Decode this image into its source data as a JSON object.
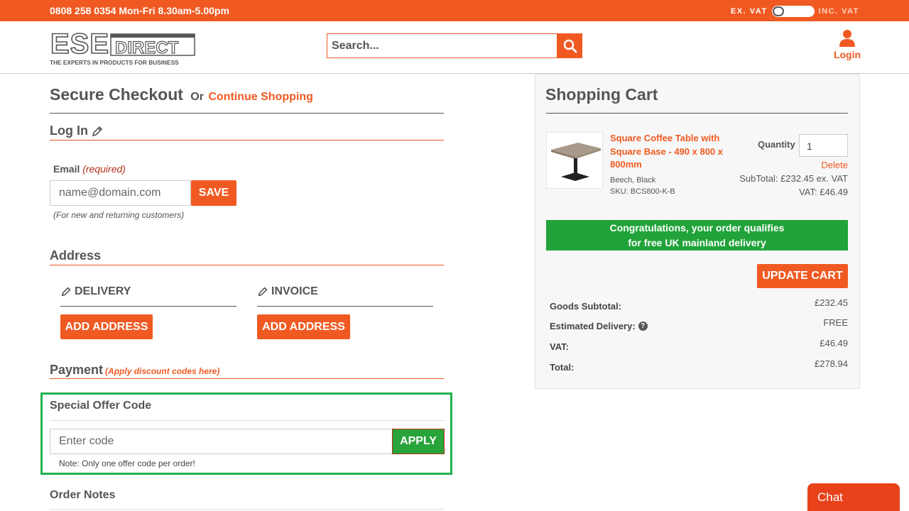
{
  "topbar": {
    "phone": "0808 258 0354 Mon-Fri 8.30am-5.00pm",
    "vat_ex": "EX. VAT",
    "vat_inc": "INC. VAT"
  },
  "header": {
    "logo_tagline": "THE EXPERTS IN PRODUCTS FOR BUSINESS",
    "logo_ese": "ESE",
    "logo_direct": "DIRECT",
    "search_placeholder": "Search...",
    "login_label": "Login"
  },
  "checkout": {
    "title": "Secure Checkout",
    "or": "Or",
    "continue_shopping": "Continue Shopping",
    "login_section": "Log In",
    "email_label": "Email",
    "email_required": "(required)",
    "email_placeholder": "name@domain.com",
    "save_label": "SAVE",
    "email_note": "(For new and returning customers)",
    "address_section": "Address",
    "delivery_label": "DELIVERY",
    "invoice_label": "INVOICE",
    "add_address_label": "ADD ADDRESS",
    "payment_section": "Payment",
    "payment_note": "(Apply discount codes here)",
    "offer_title": "Special Offer Code",
    "offer_placeholder": "Enter code",
    "apply_label": "APPLY",
    "offer_note": "Note: Only one offer code per order!",
    "order_notes": "Order Notes"
  },
  "cart": {
    "title": "Shopping Cart",
    "product_name": "Square Coffee Table with Square Base - 490 x 800 x 800mm",
    "product_variant": "Beech, Black",
    "product_sku": "SKU: BCS800-K-B",
    "quantity_label": "Quantity",
    "quantity_value": "1",
    "delete_label": "Delete",
    "subtotal_line": "SubTotal: £232.45 ex. VAT",
    "vat_line": "VAT: £46.49",
    "congrats_line1": "Congratulations, your order qualifies",
    "congrats_line2": "for free UK mainland delivery",
    "update_label": "UPDATE CART",
    "goods_subtotal_label": "Goods Subtotal:",
    "goods_subtotal_value": "£232.45",
    "delivery_label": "Estimated Delivery:",
    "delivery_value": "FREE",
    "vat_label": "VAT:",
    "vat_value": "£46.49",
    "total_label": "Total:",
    "total_value": "£278.94"
  },
  "chat": {
    "label": "Chat"
  },
  "colors": {
    "brand": "#f05a22",
    "success": "#22a33a",
    "highlight": "#22b24c"
  }
}
